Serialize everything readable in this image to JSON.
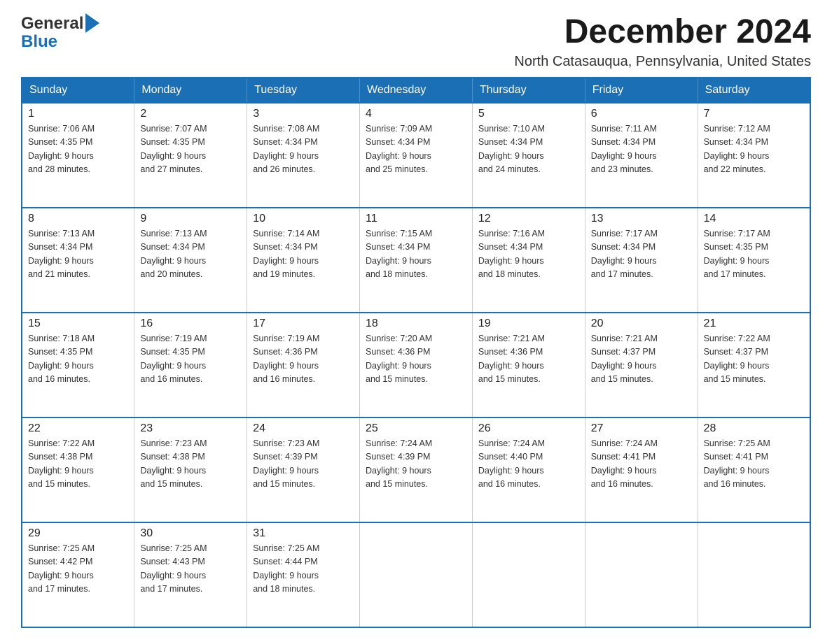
{
  "header": {
    "logo_general": "General",
    "logo_blue": "Blue",
    "month_title": "December 2024",
    "location": "North Catasauqua, Pennsylvania, United States"
  },
  "days_of_week": [
    "Sunday",
    "Monday",
    "Tuesday",
    "Wednesday",
    "Thursday",
    "Friday",
    "Saturday"
  ],
  "weeks": [
    [
      {
        "day": "1",
        "sunrise": "7:06 AM",
        "sunset": "4:35 PM",
        "daylight": "9 hours and 28 minutes."
      },
      {
        "day": "2",
        "sunrise": "7:07 AM",
        "sunset": "4:35 PM",
        "daylight": "9 hours and 27 minutes."
      },
      {
        "day": "3",
        "sunrise": "7:08 AM",
        "sunset": "4:34 PM",
        "daylight": "9 hours and 26 minutes."
      },
      {
        "day": "4",
        "sunrise": "7:09 AM",
        "sunset": "4:34 PM",
        "daylight": "9 hours and 25 minutes."
      },
      {
        "day": "5",
        "sunrise": "7:10 AM",
        "sunset": "4:34 PM",
        "daylight": "9 hours and 24 minutes."
      },
      {
        "day": "6",
        "sunrise": "7:11 AM",
        "sunset": "4:34 PM",
        "daylight": "9 hours and 23 minutes."
      },
      {
        "day": "7",
        "sunrise": "7:12 AM",
        "sunset": "4:34 PM",
        "daylight": "9 hours and 22 minutes."
      }
    ],
    [
      {
        "day": "8",
        "sunrise": "7:13 AM",
        "sunset": "4:34 PM",
        "daylight": "9 hours and 21 minutes."
      },
      {
        "day": "9",
        "sunrise": "7:13 AM",
        "sunset": "4:34 PM",
        "daylight": "9 hours and 20 minutes."
      },
      {
        "day": "10",
        "sunrise": "7:14 AM",
        "sunset": "4:34 PM",
        "daylight": "9 hours and 19 minutes."
      },
      {
        "day": "11",
        "sunrise": "7:15 AM",
        "sunset": "4:34 PM",
        "daylight": "9 hours and 18 minutes."
      },
      {
        "day": "12",
        "sunrise": "7:16 AM",
        "sunset": "4:34 PM",
        "daylight": "9 hours and 18 minutes."
      },
      {
        "day": "13",
        "sunrise": "7:17 AM",
        "sunset": "4:34 PM",
        "daylight": "9 hours and 17 minutes."
      },
      {
        "day": "14",
        "sunrise": "7:17 AM",
        "sunset": "4:35 PM",
        "daylight": "9 hours and 17 minutes."
      }
    ],
    [
      {
        "day": "15",
        "sunrise": "7:18 AM",
        "sunset": "4:35 PM",
        "daylight": "9 hours and 16 minutes."
      },
      {
        "day": "16",
        "sunrise": "7:19 AM",
        "sunset": "4:35 PM",
        "daylight": "9 hours and 16 minutes."
      },
      {
        "day": "17",
        "sunrise": "7:19 AM",
        "sunset": "4:36 PM",
        "daylight": "9 hours and 16 minutes."
      },
      {
        "day": "18",
        "sunrise": "7:20 AM",
        "sunset": "4:36 PM",
        "daylight": "9 hours and 15 minutes."
      },
      {
        "day": "19",
        "sunrise": "7:21 AM",
        "sunset": "4:36 PM",
        "daylight": "9 hours and 15 minutes."
      },
      {
        "day": "20",
        "sunrise": "7:21 AM",
        "sunset": "4:37 PM",
        "daylight": "9 hours and 15 minutes."
      },
      {
        "day": "21",
        "sunrise": "7:22 AM",
        "sunset": "4:37 PM",
        "daylight": "9 hours and 15 minutes."
      }
    ],
    [
      {
        "day": "22",
        "sunrise": "7:22 AM",
        "sunset": "4:38 PM",
        "daylight": "9 hours and 15 minutes."
      },
      {
        "day": "23",
        "sunrise": "7:23 AM",
        "sunset": "4:38 PM",
        "daylight": "9 hours and 15 minutes."
      },
      {
        "day": "24",
        "sunrise": "7:23 AM",
        "sunset": "4:39 PM",
        "daylight": "9 hours and 15 minutes."
      },
      {
        "day": "25",
        "sunrise": "7:24 AM",
        "sunset": "4:39 PM",
        "daylight": "9 hours and 15 minutes."
      },
      {
        "day": "26",
        "sunrise": "7:24 AM",
        "sunset": "4:40 PM",
        "daylight": "9 hours and 16 minutes."
      },
      {
        "day": "27",
        "sunrise": "7:24 AM",
        "sunset": "4:41 PM",
        "daylight": "9 hours and 16 minutes."
      },
      {
        "day": "28",
        "sunrise": "7:25 AM",
        "sunset": "4:41 PM",
        "daylight": "9 hours and 16 minutes."
      }
    ],
    [
      {
        "day": "29",
        "sunrise": "7:25 AM",
        "sunset": "4:42 PM",
        "daylight": "9 hours and 17 minutes."
      },
      {
        "day": "30",
        "sunrise": "7:25 AM",
        "sunset": "4:43 PM",
        "daylight": "9 hours and 17 minutes."
      },
      {
        "day": "31",
        "sunrise": "7:25 AM",
        "sunset": "4:44 PM",
        "daylight": "9 hours and 18 minutes."
      },
      null,
      null,
      null,
      null
    ]
  ],
  "labels": {
    "sunrise": "Sunrise:",
    "sunset": "Sunset:",
    "daylight": "Daylight:"
  }
}
